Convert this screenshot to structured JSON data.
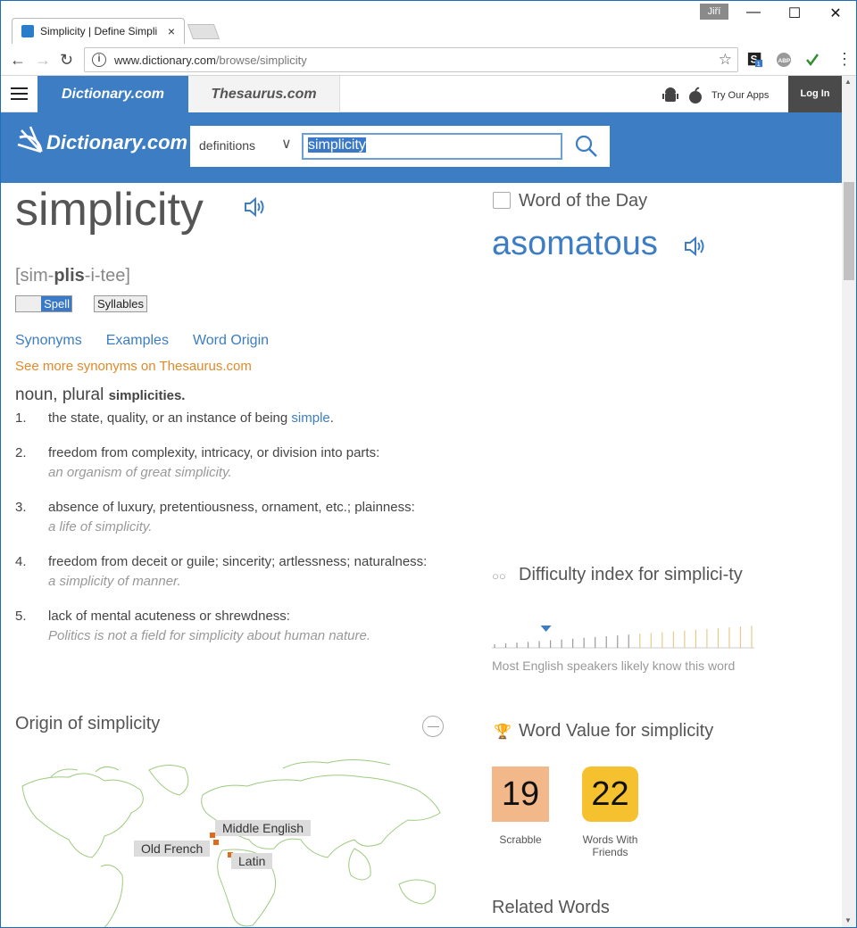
{
  "browser": {
    "tab_title": "Simplicity | Define Simpli",
    "tab_close": "×",
    "user_badge": "Jiří",
    "window_controls": {
      "minimize": "—",
      "maximize": "☐",
      "close": "✕"
    },
    "url_host": "www.dictionary.com",
    "url_path": "/browse/simplicity",
    "ext_badge": "1"
  },
  "nav": {
    "tab_dictionary": "Dictionary.com",
    "tab_thesaurus": "Thesaurus.com",
    "apps_label": "Try Our Apps",
    "login": "Log In"
  },
  "header": {
    "logo": "Dictionary.com",
    "search_type": "definitions",
    "search_value": "simplicity"
  },
  "entry": {
    "word": "simplicity",
    "pron_pre": "[sim-",
    "pron_bold": "plis",
    "pron_post": "-i-tee]",
    "spell_label": "Spell",
    "syllables_label": "Syllables",
    "links": [
      "Synonyms",
      "Examples",
      "Word Origin"
    ],
    "more_synonyms": "See more synonyms on Thesaurus.com",
    "pos": "noun,",
    "plural_label": "plural",
    "plural_form": "simplicities.",
    "definitions": [
      {
        "n": "1.",
        "text": "the state, quality, or an instance of being ",
        "link": "simple",
        "tail": ".",
        "example": ""
      },
      {
        "n": "2.",
        "text": "freedom from complexity, intricacy, or division into parts:",
        "link": "",
        "tail": "",
        "example": "an organism of great simplicity."
      },
      {
        "n": "3.",
        "text": "absence of luxury, pretentiousness, ornament, etc.; plainness:",
        "link": "",
        "tail": "",
        "example": "a life of simplicity."
      },
      {
        "n": "4.",
        "text": "freedom from deceit or guile; sincerity; artlessness; naturalness:",
        "link": "",
        "tail": "",
        "example": "a simplicity of manner."
      },
      {
        "n": "5.",
        "text": "lack of mental acuteness or shrewdness:",
        "link": "",
        "tail": "",
        "example": "Politics is not a field for simplicity about human nature."
      }
    ],
    "origin_heading": "Origin of simplicity",
    "origin_tags": [
      "Middle English",
      "Old French",
      "Latin"
    ]
  },
  "sidebar": {
    "wotd_heading": "Word of the Day",
    "wotd_word": "asomatous",
    "difficulty_heading": "Difficulty index for simplici-ty",
    "difficulty_level": 0.2,
    "difficulty_text": "Most English speakers likely know this word",
    "word_value_heading": "Word Value for simplicity",
    "scrabble_value": "19",
    "scrabble_label": "Scrabble",
    "wwf_value": "22",
    "wwf_label": "Words With Friends",
    "related_heading": "Related Words"
  },
  "colors": {
    "brand_blue": "#3c7dc4",
    "orange": "#e08a2a",
    "scrabble": "#f3b889",
    "wwf": "#f6c12f"
  }
}
